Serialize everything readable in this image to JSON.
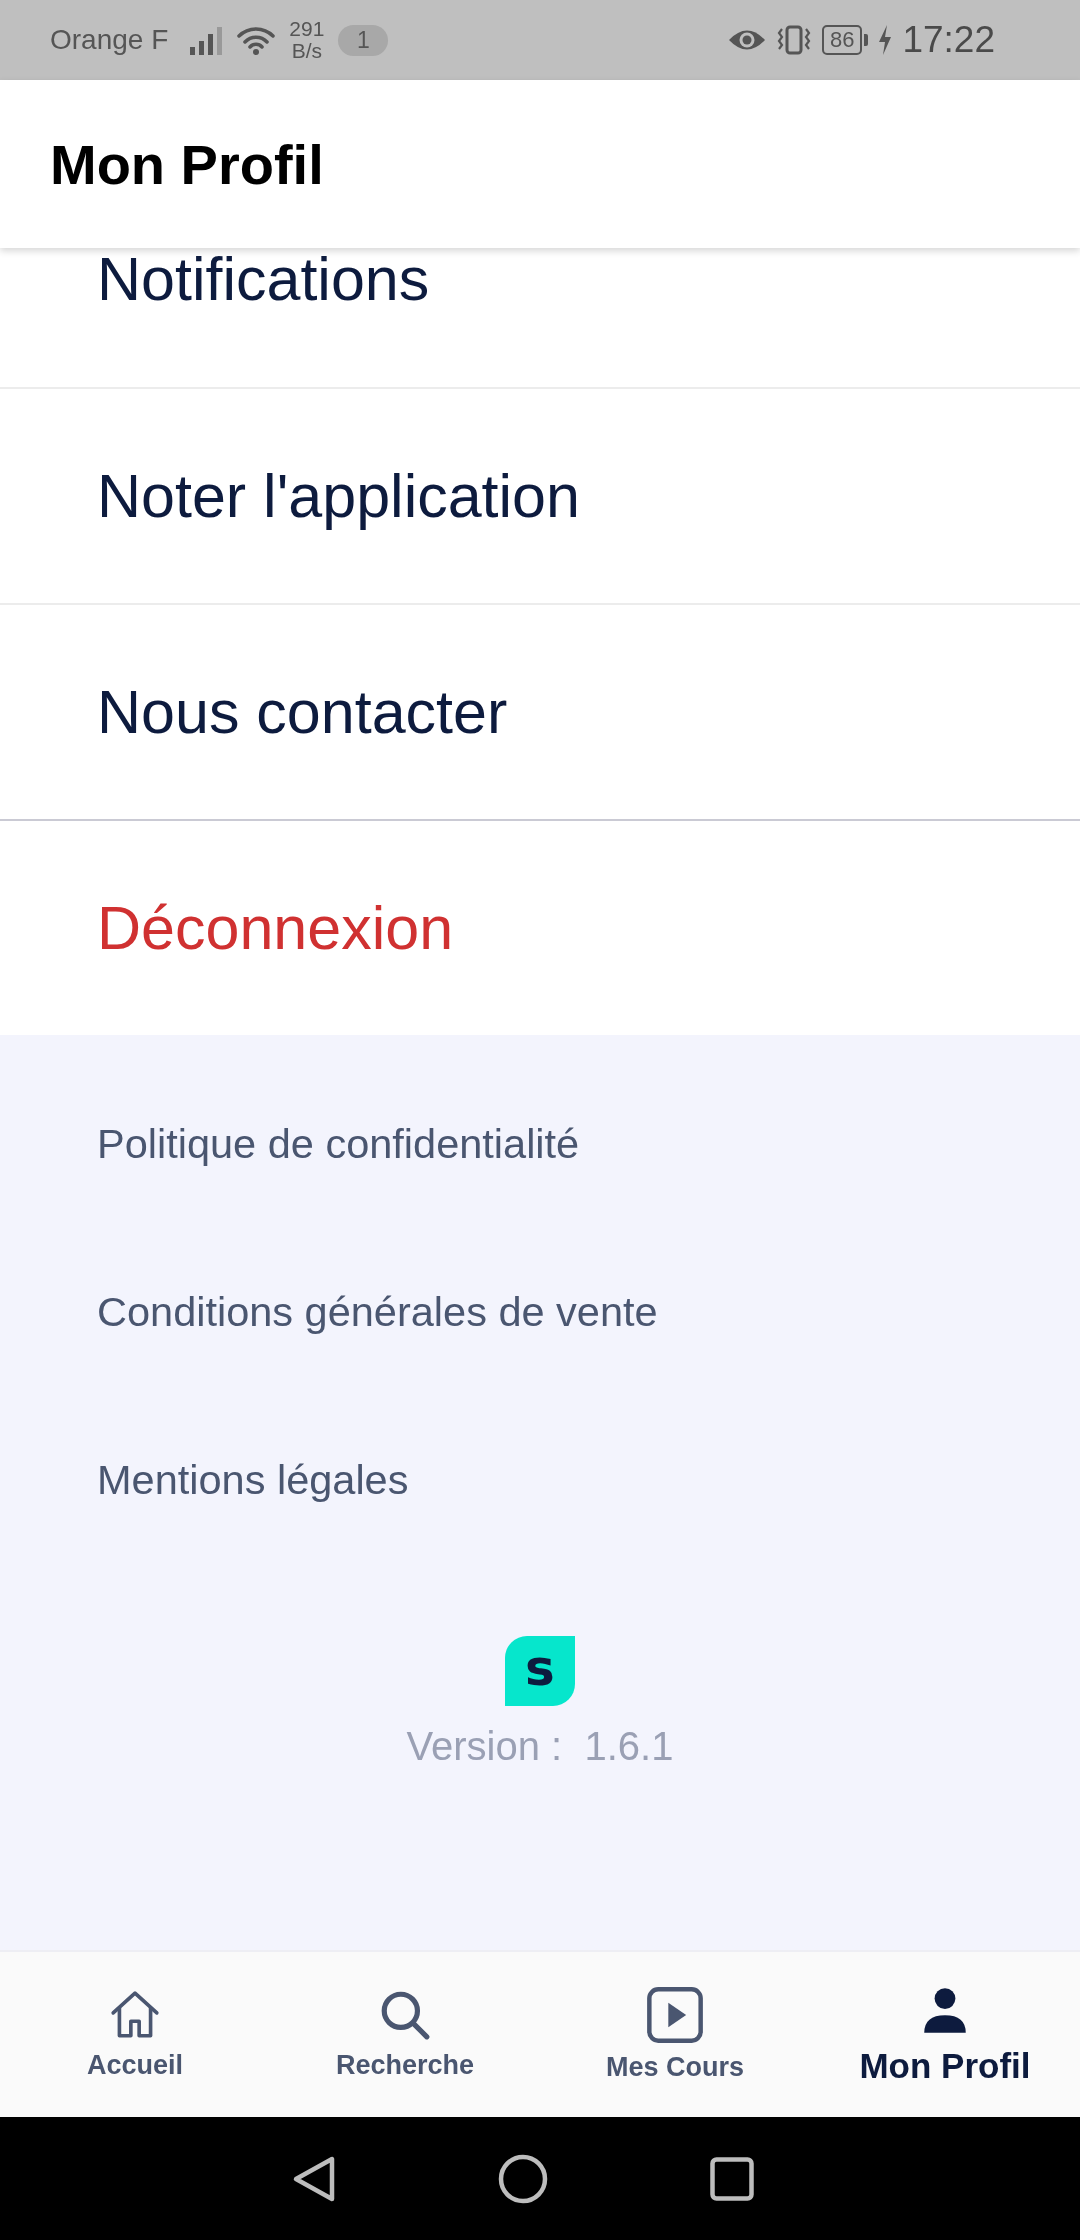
{
  "status_bar": {
    "carrier": "Orange F",
    "net_speed_value": "291",
    "net_speed_unit": "B/s",
    "notification_count": "1",
    "battery": "86",
    "time": "17:22"
  },
  "header": {
    "title": "Mon Profil"
  },
  "menu": [
    {
      "label": "Notifications",
      "kind": "normal"
    },
    {
      "label": "Noter l'application",
      "kind": "normal"
    },
    {
      "label": "Nous contacter",
      "kind": "normal"
    },
    {
      "label": "Déconnexion",
      "kind": "danger"
    }
  ],
  "footer_links": [
    "Politique de confidentialité",
    "Conditions générales de vente",
    "Mentions légales"
  ],
  "logo": {
    "letter": "s"
  },
  "version": "Version :  1.6.1",
  "bottom_nav": [
    {
      "label": "Accueil",
      "selected": false
    },
    {
      "label": "Recherche",
      "selected": false
    },
    {
      "label": "Mes Cours",
      "selected": false
    },
    {
      "label": "Mon Profil",
      "selected": true
    }
  ]
}
